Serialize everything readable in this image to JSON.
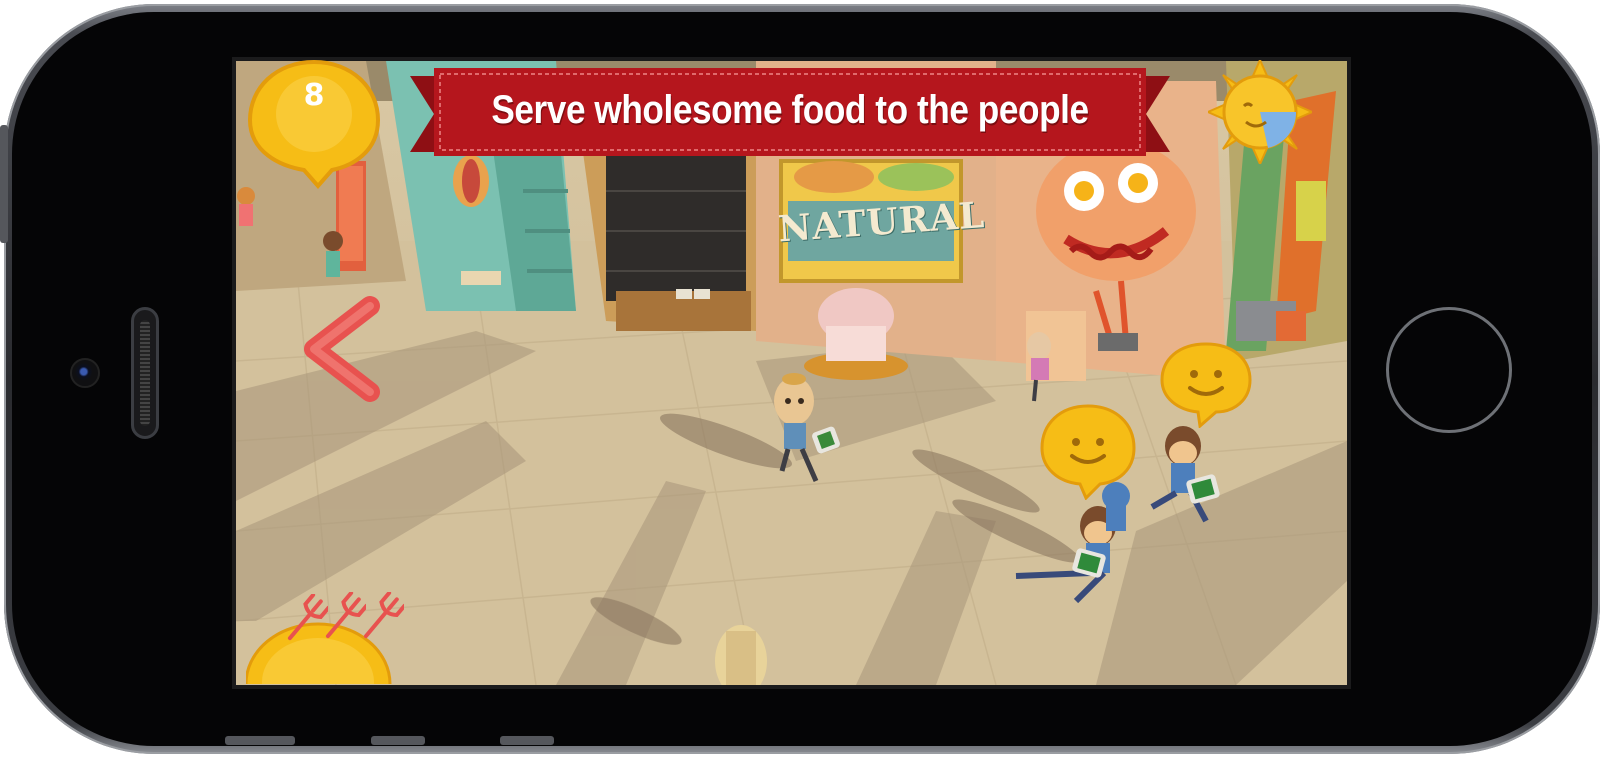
{
  "hud": {
    "score": "8",
    "objective": "Serve wholesome food to the people",
    "time_icon": "sun-clock-icon",
    "back_icon": "chevron-left-icon",
    "lives_icon": "fork-icon",
    "mood_icon": "happy-face-icon"
  },
  "scene": {
    "shop_sign": "NATURAL"
  },
  "colors": {
    "banner_red": "#b5161d",
    "badge_yellow": "#f6bd16",
    "back_arrow": "#e8524f",
    "ground": "#d4c29e"
  }
}
